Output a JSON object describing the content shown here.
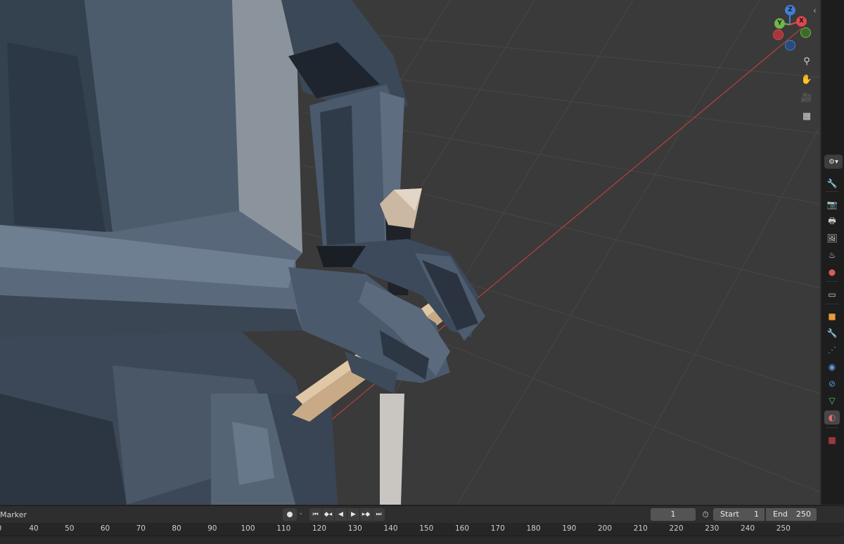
{
  "viewport": {
    "gizmo_axes": {
      "x": "X",
      "y": "Y",
      "z": "Z"
    },
    "nav_tools": [
      {
        "icon": "zoom-icon",
        "glyph": "⚲"
      },
      {
        "icon": "hand-pan-icon",
        "glyph": "✋"
      },
      {
        "icon": "camera-view-icon",
        "glyph": "🎥"
      },
      {
        "icon": "perspective-grid-icon",
        "glyph": "▦"
      }
    ]
  },
  "properties_tabs": [
    {
      "name": "tool-tab",
      "glyph": "🔧",
      "color": "#cfcfcf"
    },
    {
      "name": "render-tab",
      "glyph": "📷",
      "color": "#cfcfcf"
    },
    {
      "name": "output-tab",
      "glyph": "🖶",
      "color": "#cfcfcf"
    },
    {
      "name": "view-layer-tab",
      "glyph": "🖼",
      "color": "#cfcfcf"
    },
    {
      "name": "scene-tab",
      "glyph": "♨",
      "color": "#cfcfcf"
    },
    {
      "name": "world-tab",
      "glyph": "●",
      "color": "#d35c5c"
    },
    {
      "name": "collection-tab",
      "glyph": "▭",
      "color": "#cfcfcf"
    },
    {
      "name": "object-tab",
      "glyph": "■",
      "color": "#e99b3b"
    },
    {
      "name": "modifiers-tab",
      "glyph": "🔧",
      "color": "#5a9ee8"
    },
    {
      "name": "particles-tab",
      "glyph": "⋰",
      "color": "#5a9ee8"
    },
    {
      "name": "physics-tab",
      "glyph": "◉",
      "color": "#5a9ee8"
    },
    {
      "name": "constraints-tab",
      "glyph": "⊘",
      "color": "#5a9ee8"
    },
    {
      "name": "data-tab",
      "glyph": "▽",
      "color": "#56c77a"
    },
    {
      "name": "material-tab",
      "glyph": "◐",
      "color": "#e07070"
    },
    {
      "name": "texture-tab",
      "glyph": "▩",
      "color": "#d94d4d"
    }
  ],
  "timeline": {
    "marker_label": "Marker",
    "current_frame": "1",
    "start_label": "Start",
    "start_value": "1",
    "end_label": "End",
    "end_value": "250",
    "ruler_ticks": [
      "40",
      "50",
      "60",
      "70",
      "80",
      "90",
      "100",
      "110",
      "120",
      "130",
      "140",
      "150",
      "160",
      "170",
      "180",
      "190",
      "200",
      "210",
      "220",
      "230",
      "240",
      "250"
    ],
    "ruler_first_partial": "0"
  },
  "colors": {
    "viewport_bg": "#3a3a3a",
    "x_axis_line": "#b0403f",
    "gizmo_x": "#e0474c",
    "gizmo_y": "#72b54a",
    "gizmo_z": "#3f7fd6"
  }
}
